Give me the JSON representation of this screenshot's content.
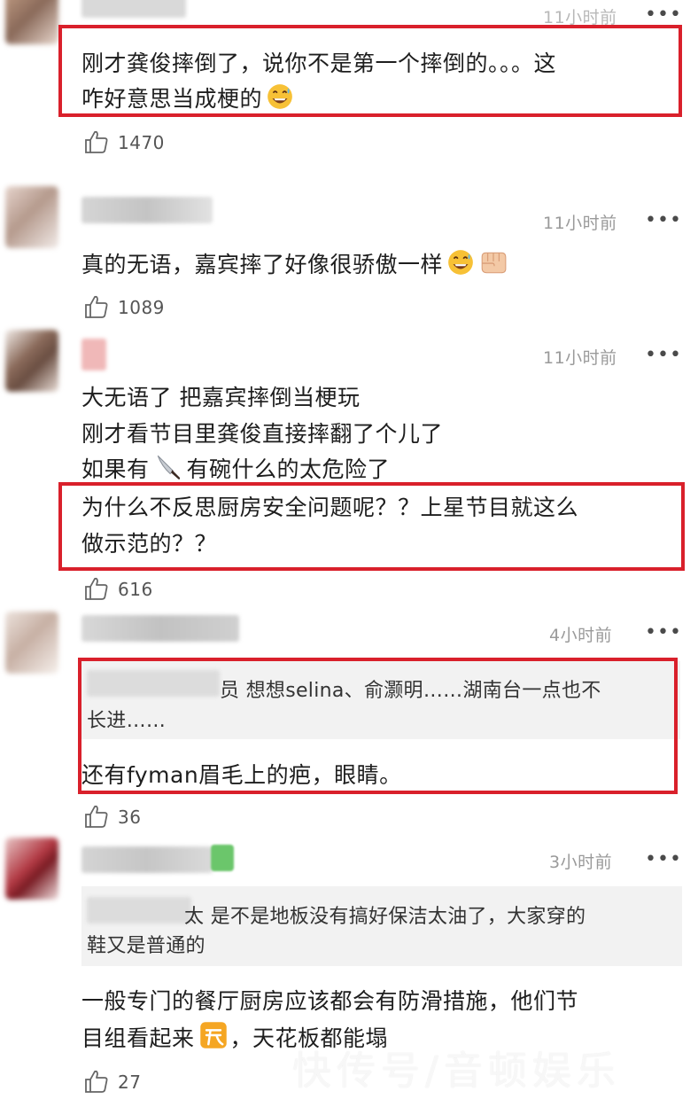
{
  "comments": [
    {
      "time": "11小时前",
      "more": "•••",
      "lines": [
        "刚才龚俊摔倒了，说你不是第一个摔倒的。。。这",
        "咋好意思当成梗的"
      ],
      "emoji_after_last_line": "grinning-sweat-emoji",
      "likes": "1470"
    },
    {
      "time": "11小时前",
      "more": "•••",
      "lines": [
        "真的无语，嘉宾摔了好像很骄傲一样"
      ],
      "emojis_after_line": [
        "grinning-sweat-emoji",
        "fist-emoji"
      ],
      "likes": "1089"
    },
    {
      "time": "11小时前",
      "more": "•••",
      "lines": [
        "大无语了 把嘉宾摔倒当梗玩",
        "刚才看节目里龚俊直接摔翻了个儿了",
        "如果有",
        "有碗什么的太危险了",
        "为什么不反思厨房安全问题呢？？上星节目就这么",
        "做示范的？？"
      ],
      "inline_icon": "knife-emoji",
      "likes": "616"
    },
    {
      "time": "4小时前",
      "more": "•••",
      "quote_lines": [
        "员 想想selina、俞灏明……湖南台一点也不",
        "长进……"
      ],
      "lines": [
        "还有fyman眉毛上的疤，眼睛。"
      ],
      "likes": "36"
    },
    {
      "time": "3小时前",
      "more": "•••",
      "quote_lines": [
        "太 是不是地板没有搞好保洁太油了，大家穿的",
        "鞋又是普通的"
      ],
      "lines": [
        "一般专门的餐厅厨房应该都会有防滑措施，他们节",
        "目组看起来",
        "，天花板都能塌"
      ],
      "inline_icon": "angry-qi-emoji",
      "likes": "27"
    }
  ],
  "watermark": "快传号/音顿娱乐",
  "colors": {
    "highlight": "#d9202b",
    "time": "#9a9a9a",
    "quote_bg": "#f2f2f2"
  }
}
